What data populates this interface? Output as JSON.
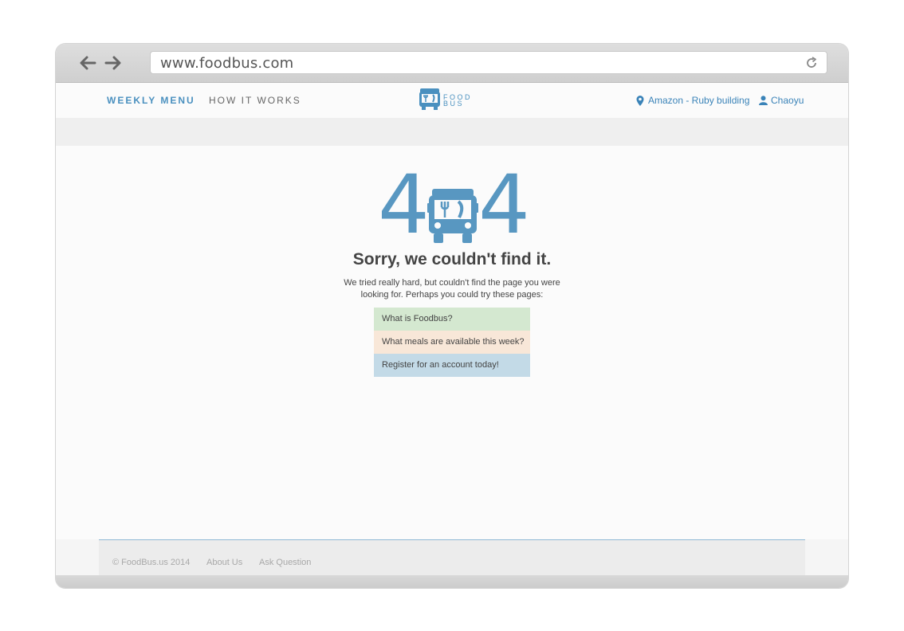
{
  "browser": {
    "url": "www.foodbus.com"
  },
  "header": {
    "nav": [
      "WEEKLY MENU",
      "HOW IT WORKS"
    ],
    "logo_text_top": "FOOD",
    "logo_text_bottom": "BUS",
    "location": "Amazon - Ruby building",
    "user": "Chaoyu"
  },
  "main": {
    "big_left": "4",
    "big_right": "4",
    "title": "Sorry, we couldn't find it.",
    "subtitle": "We tried really hard, but couldn't find the page you were looking for. Perhaps you could try these pages:",
    "suggestions": [
      "What is Foodbus?",
      "What meals are available this week?",
      "Register for an account today!"
    ]
  },
  "footer": {
    "copyright": "© FoodBus.us 2014",
    "about": "About Us",
    "ask": "Ask Question"
  },
  "colors": {
    "accent": "#4a90bf",
    "suggestion_green": "#d4e8d0",
    "suggestion_peach": "#f8e7d8",
    "suggestion_blue": "#c3dae7"
  }
}
